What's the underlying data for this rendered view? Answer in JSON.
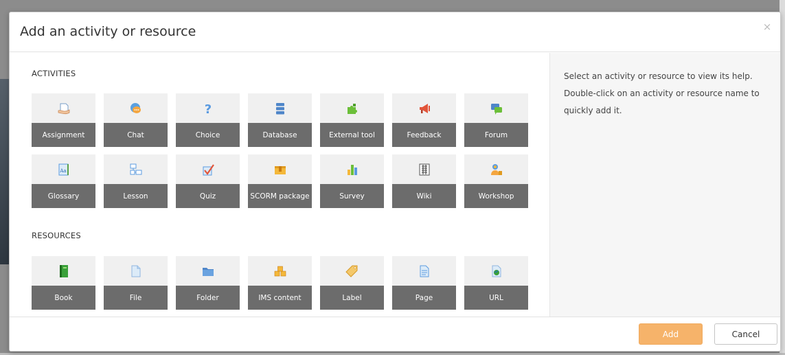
{
  "dialog": {
    "title": "Add an activity or resource",
    "close_symbol": "×"
  },
  "activities": {
    "heading": "ACTIVITIES",
    "items": [
      {
        "label": "Assignment",
        "icon": "assignment-icon"
      },
      {
        "label": "Chat",
        "icon": "chat-icon"
      },
      {
        "label": "Choice",
        "icon": "choice-icon"
      },
      {
        "label": "Database",
        "icon": "database-icon"
      },
      {
        "label": "External tool",
        "icon": "external-tool-icon"
      },
      {
        "label": "Feedback",
        "icon": "feedback-icon"
      },
      {
        "label": "Forum",
        "icon": "forum-icon"
      },
      {
        "label": "Glossary",
        "icon": "glossary-icon"
      },
      {
        "label": "Lesson",
        "icon": "lesson-icon"
      },
      {
        "label": "Quiz",
        "icon": "quiz-icon"
      },
      {
        "label": "SCORM package",
        "icon": "scorm-package-icon"
      },
      {
        "label": "Survey",
        "icon": "survey-icon"
      },
      {
        "label": "Wiki",
        "icon": "wiki-icon"
      },
      {
        "label": "Workshop",
        "icon": "workshop-icon"
      }
    ]
  },
  "resources": {
    "heading": "RESOURCES",
    "items": [
      {
        "label": "Book",
        "icon": "book-icon"
      },
      {
        "label": "File",
        "icon": "file-icon"
      },
      {
        "label": "Folder",
        "icon": "folder-icon"
      },
      {
        "label": "IMS content",
        "icon": "ims-content-icon"
      },
      {
        "label": "Label",
        "icon": "label-icon"
      },
      {
        "label": "Page",
        "icon": "page-icon"
      },
      {
        "label": "URL",
        "icon": "url-icon"
      }
    ]
  },
  "help": {
    "text": "Select an activity or resource to view its help. Double-click on an activity or resource name to quickly add it."
  },
  "footer": {
    "add_label": "Add",
    "cancel_label": "Cancel"
  },
  "colors": {
    "tile_background": "#f0f0f0",
    "tile_label_background": "#6c6c6c",
    "add_button": "#f6b36a",
    "help_pane_background": "#f6f6f6"
  }
}
